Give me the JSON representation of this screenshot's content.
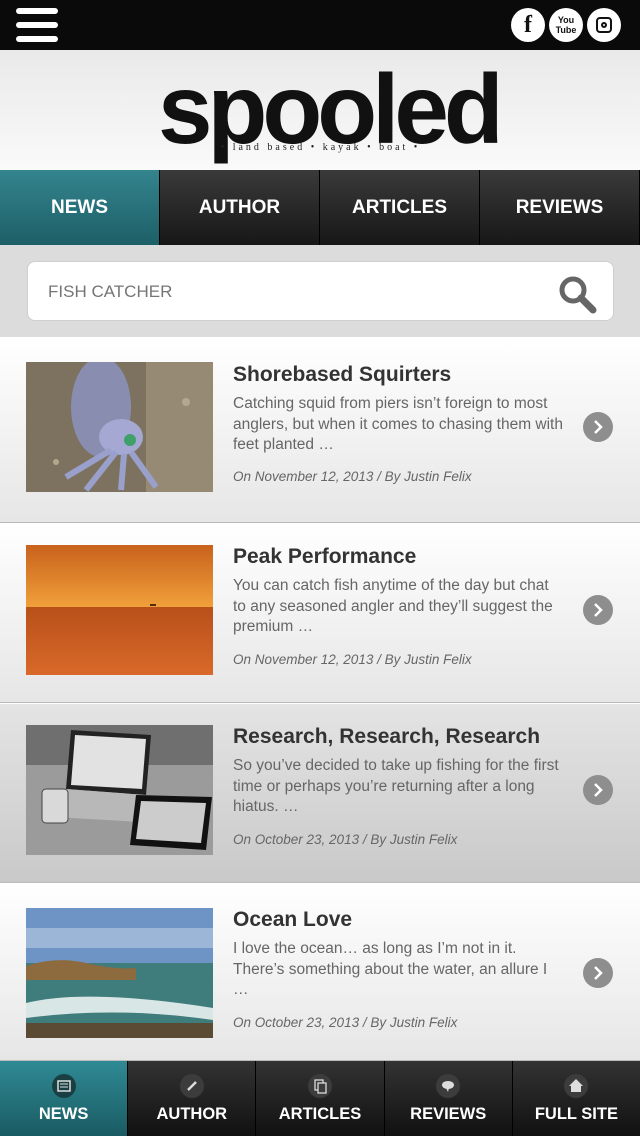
{
  "header": {
    "social": {
      "facebook_label": "f",
      "youtube_label_line1": "You",
      "youtube_label_line2": "Tube"
    }
  },
  "logo": {
    "wordmark": "spooled",
    "tagline": "• land based • kayak • boat •"
  },
  "nav": {
    "tabs": [
      {
        "label": "NEWS",
        "active": true
      },
      {
        "label": "AUTHOR",
        "active": false
      },
      {
        "label": "ARTICLES",
        "active": false
      },
      {
        "label": "REVIEWS",
        "active": false
      }
    ]
  },
  "search": {
    "placeholder": "FISH CATCHER"
  },
  "articles": [
    {
      "title": "Shorebased Squirters",
      "excerpt": "Catching squid from piers isn’t foreign to most anglers, but when it comes to chasing them with feet planted …",
      "meta": "On November 12, 2013 / By Justin Felix",
      "thumb": "squid"
    },
    {
      "title": "Peak Performance",
      "excerpt": "You can catch fish anytime of the day but chat to any seasoned angler and they’ll suggest the premium …",
      "meta": "On November 12, 2013 / By Justin Felix",
      "thumb": "sunset"
    },
    {
      "title": "Research, Research, Research",
      "excerpt": "So you’ve decided to take up fishing for the first time or perhaps you’re returning after a long hiatus. …",
      "meta": "On October 23, 2013 / By Justin Felix",
      "thumb": "devices"
    },
    {
      "title": "Ocean Love",
      "excerpt": "I love the ocean… as long as I’m not in it. There’s something about the water, an allure I …",
      "meta": "On October 23, 2013 / By Justin Felix",
      "thumb": "coast"
    }
  ],
  "bottom_nav": {
    "tabs": [
      {
        "label": "NEWS",
        "icon": "newspaper-icon",
        "active": true
      },
      {
        "label": "AUTHOR",
        "icon": "pencil-icon",
        "active": false
      },
      {
        "label": "ARTICLES",
        "icon": "documents-icon",
        "active": false
      },
      {
        "label": "REVIEWS",
        "icon": "speech-bubble-icon",
        "active": false
      },
      {
        "label": "FULL SITE",
        "icon": "home-icon",
        "active": false
      }
    ]
  },
  "colors": {
    "accent_teal": "#2a7a84",
    "header_black": "#0a0a0a"
  }
}
